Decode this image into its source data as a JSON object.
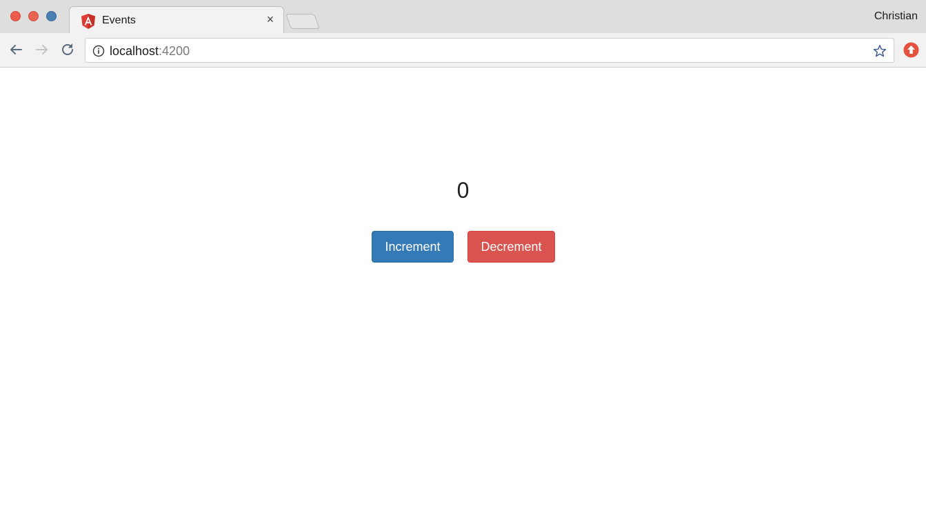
{
  "browser": {
    "tab": {
      "title": "Events",
      "favicon": "angular-icon"
    },
    "profile_name": "Christian",
    "address": {
      "host": "localhost",
      "port": ":4200"
    },
    "colors": {
      "accent_blue": "#337ab7",
      "accent_red": "#d9534f"
    }
  },
  "page": {
    "counter_value": "0",
    "increment_label": "Increment",
    "decrement_label": "Decrement"
  }
}
